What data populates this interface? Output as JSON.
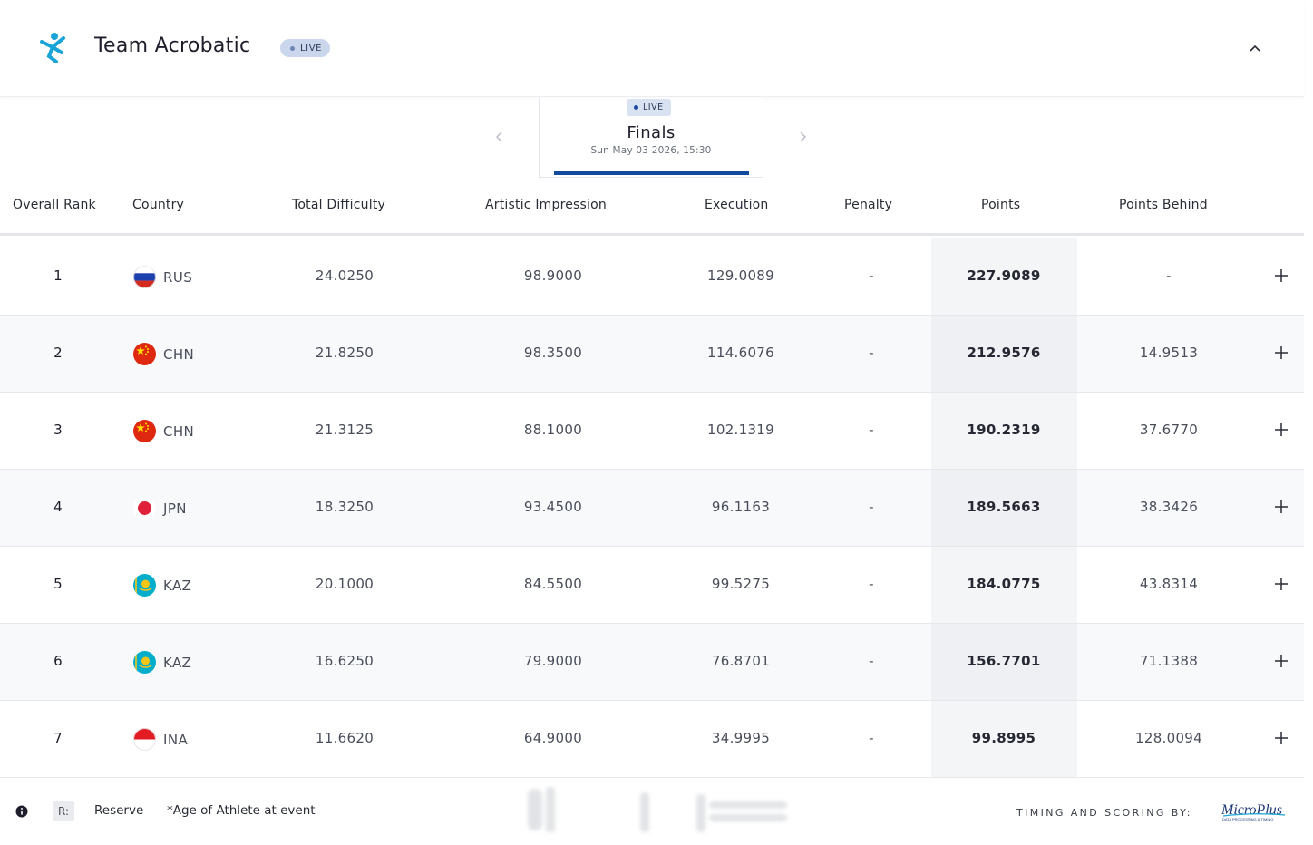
{
  "header": {
    "title": "Team Acrobatic",
    "live_badge": "LIVE",
    "icons": {
      "logo": "gymnast-logo-icon",
      "collapse": "chevron-up-icon"
    }
  },
  "phase": {
    "live_badge": "LIVE",
    "title": "Finals",
    "date": "Sun May 03 2026, 15:30",
    "icons": {
      "prev": "chevron-left-icon",
      "next": "chevron-right-icon"
    }
  },
  "table": {
    "columns": [
      "Overall Rank",
      "Country",
      "Total Difficulty",
      "Artistic Impression",
      "Execution",
      "Penalty",
      "Points",
      "Points Behind"
    ],
    "rows": [
      {
        "rank": "1",
        "country": "RUS",
        "flag": "russia-flag-icon",
        "difficulty": "24.0250",
        "artistic": "98.9000",
        "execution": "129.0089",
        "penalty": "-",
        "points": "227.9089",
        "behind": "-"
      },
      {
        "rank": "2",
        "country": "CHN",
        "flag": "china-flag-icon",
        "difficulty": "21.8250",
        "artistic": "98.3500",
        "execution": "114.6076",
        "penalty": "-",
        "points": "212.9576",
        "behind": "14.9513"
      },
      {
        "rank": "3",
        "country": "CHN",
        "flag": "china-flag-icon",
        "difficulty": "21.3125",
        "artistic": "88.1000",
        "execution": "102.1319",
        "penalty": "-",
        "points": "190.2319",
        "behind": "37.6770"
      },
      {
        "rank": "4",
        "country": "JPN",
        "flag": "japan-flag-icon",
        "difficulty": "18.3250",
        "artistic": "93.4500",
        "execution": "96.1163",
        "penalty": "-",
        "points": "189.5663",
        "behind": "38.3426"
      },
      {
        "rank": "5",
        "country": "KAZ",
        "flag": "kazakhstan-flag-icon",
        "difficulty": "20.1000",
        "artistic": "84.5500",
        "execution": "99.5275",
        "penalty": "-",
        "points": "184.0775",
        "behind": "43.8314"
      },
      {
        "rank": "6",
        "country": "KAZ",
        "flag": "kazakhstan-flag-icon",
        "difficulty": "16.6250",
        "artistic": "79.9000",
        "execution": "76.8701",
        "penalty": "-",
        "points": "156.7701",
        "behind": "71.1388"
      },
      {
        "rank": "7",
        "country": "INA",
        "flag": "indonesia-flag-icon",
        "difficulty": "11.6620",
        "artistic": "64.9000",
        "execution": "34.9995",
        "penalty": "-",
        "points": "99.8995",
        "behind": "128.0094"
      }
    ],
    "expand_icon": "plus-icon"
  },
  "footer": {
    "reserve_key": "R:",
    "reserve_label": "Reserve",
    "age_note": "*Age of Athlete at event",
    "timing_label": "TIMING AND SCORING BY:",
    "brand": "MicroPlus",
    "brand_sub": "DATA PROCESSING & TIMING",
    "icons": {
      "info": "info-icon",
      "brand": "microplus-logo-icon"
    }
  },
  "colors": {
    "accent": "#134a9e",
    "live_pill": "#c9d6ec",
    "logo_blue": "#1aa3d6"
  }
}
